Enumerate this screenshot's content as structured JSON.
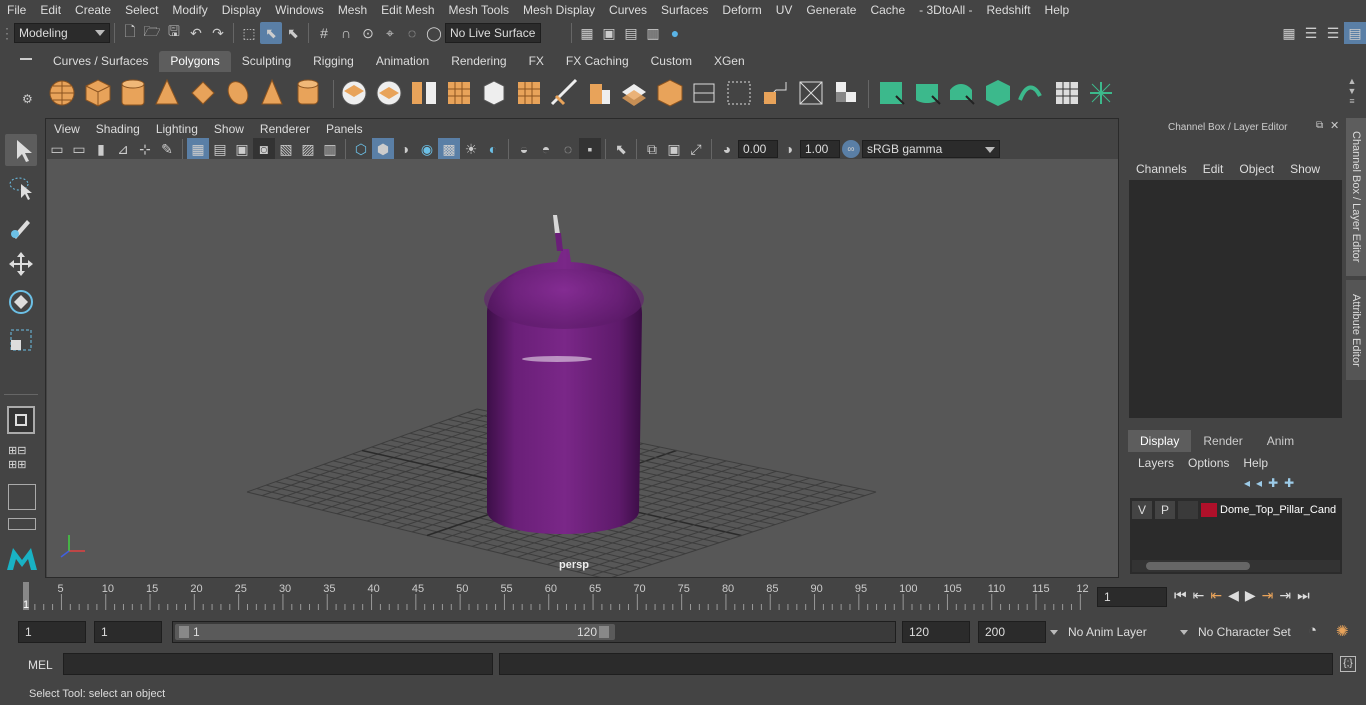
{
  "menubar": [
    "File",
    "Edit",
    "Create",
    "Select",
    "Modify",
    "Display",
    "Windows",
    "Mesh",
    "Edit Mesh",
    "Mesh Tools",
    "Mesh Display",
    "Curves",
    "Surfaces",
    "Deform",
    "UV",
    "Generate",
    "Cache",
    "- 3DtoAll -",
    "Redshift",
    "Help"
  ],
  "status": {
    "mode": "Modeling",
    "live_surface": "No Live Surface"
  },
  "shelf_tabs": [
    "Curves / Surfaces",
    "Polygons",
    "Sculpting",
    "Rigging",
    "Animation",
    "Rendering",
    "FX",
    "FX Caching",
    "Custom",
    "XGen"
  ],
  "active_shelf_tab": "Polygons",
  "viewport": {
    "menus": [
      "View",
      "Shading",
      "Lighting",
      "Show",
      "Renderer",
      "Panels"
    ],
    "exposure": "0.00",
    "gamma": "1.00",
    "colorspace": "sRGB gamma",
    "camera": "persp"
  },
  "channel_box": {
    "title": "Channel Box / Layer Editor",
    "menus": [
      "Channels",
      "Edit",
      "Object",
      "Show"
    ]
  },
  "layer_editor": {
    "tabs": [
      "Display",
      "Render",
      "Anim"
    ],
    "menus": [
      "Layers",
      "Options",
      "Help"
    ],
    "layer": {
      "v": "V",
      "p": "P",
      "name": "Dome_Top_Pillar_Cand",
      "color": "#b0102a"
    }
  },
  "side_tabs": {
    "channel": "Channel Box / Layer Editor",
    "attr": "Attribute Editor"
  },
  "timeline": {
    "ticks": [
      "5",
      "10",
      "15",
      "20",
      "25",
      "30",
      "35",
      "40",
      "45",
      "50",
      "55",
      "60",
      "65",
      "70",
      "75",
      "80",
      "85",
      "90",
      "95",
      "100",
      "105",
      "110",
      "115",
      "12"
    ],
    "start_label": "1",
    "current_frame": "1"
  },
  "range": {
    "start": "1",
    "anim_start": "1",
    "slider_start": "1",
    "slider_end": "120",
    "end": "120",
    "anim_end": "200",
    "anim_layer": "No Anim Layer",
    "char_set": "No Character Set"
  },
  "cmd": {
    "label": "MEL"
  },
  "help": "Select Tool: select an object",
  "colors": {
    "candle": "#6a1f78",
    "bg": "#444444"
  }
}
